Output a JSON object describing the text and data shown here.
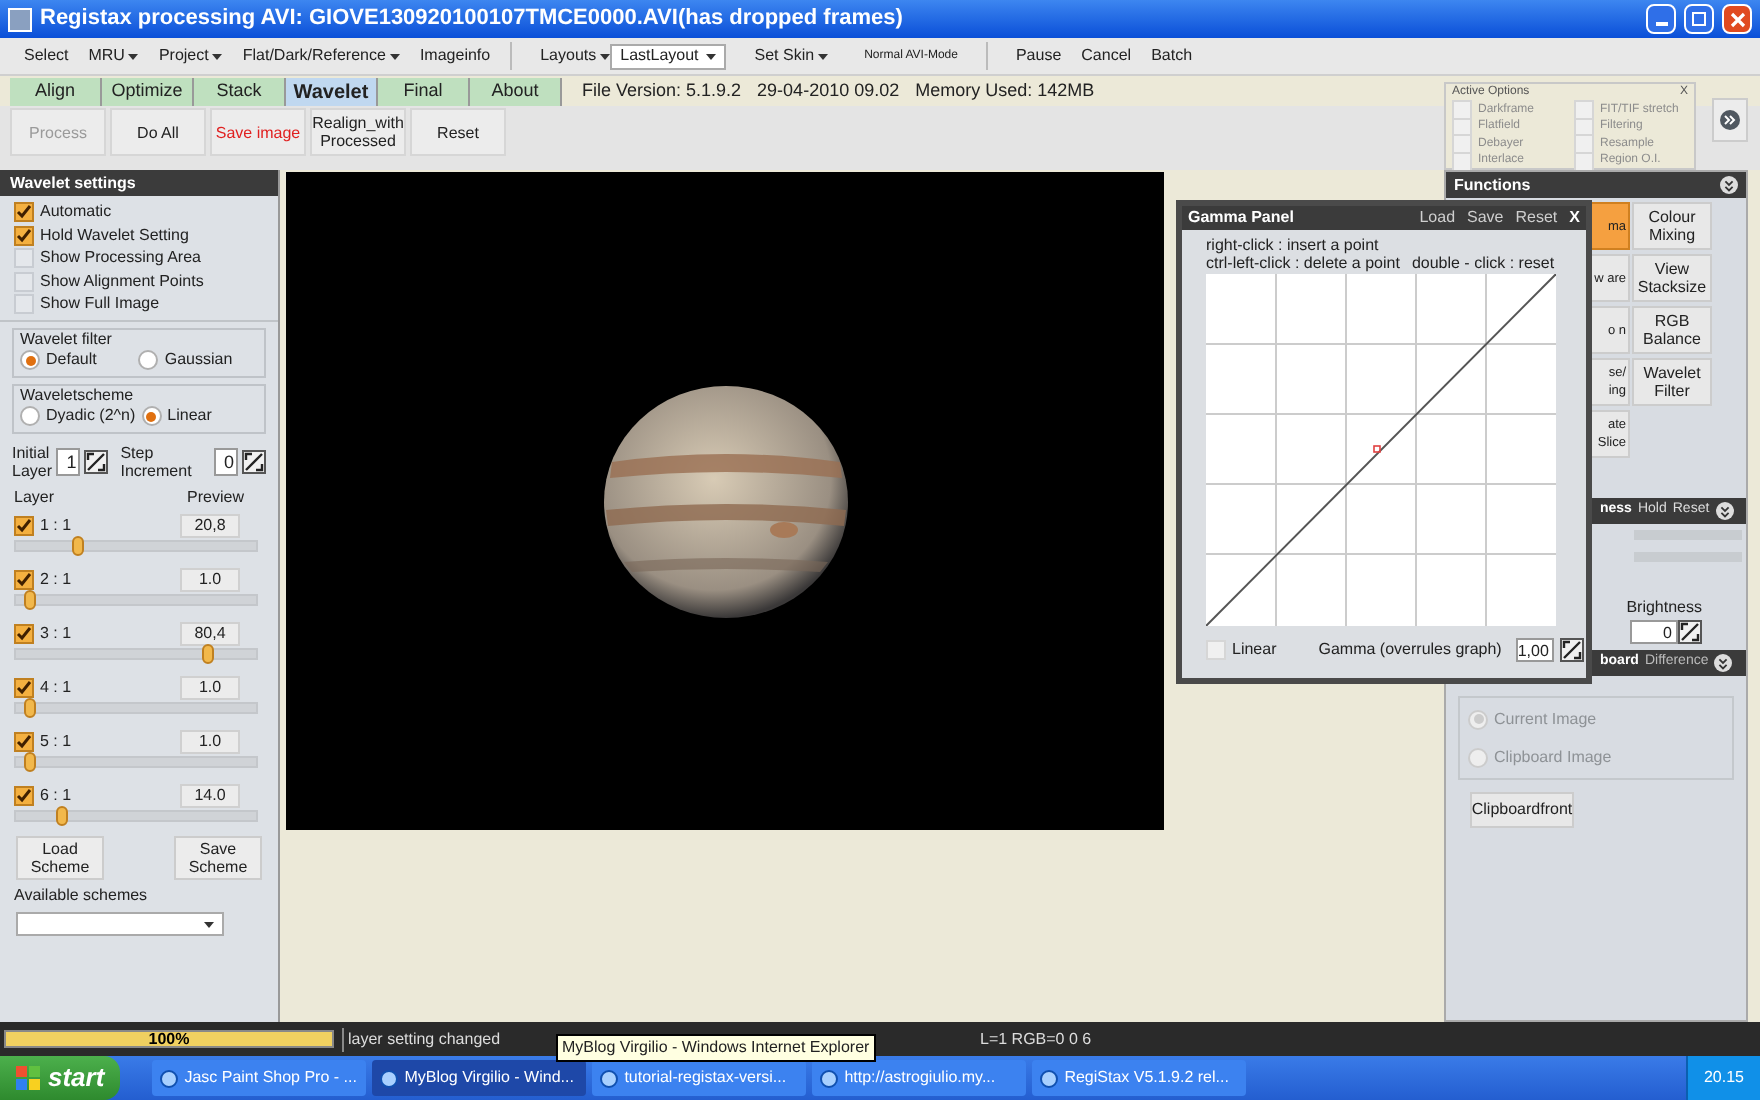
{
  "window": {
    "title": "Registax processing AVI: GIOVE130920100107TMCE0000.AVI(has dropped frames)"
  },
  "menu": [
    {
      "kind": "menu",
      "label": "Select",
      "dropdown": false
    },
    {
      "kind": "menu",
      "label": "MRU",
      "dropdown": true
    },
    {
      "kind": "menu",
      "label": "Project",
      "dropdown": true
    },
    {
      "kind": "menu",
      "label": "Flat/Dark/Reference",
      "dropdown": true
    },
    {
      "kind": "menu",
      "label": "Imageinfo",
      "dropdown": false
    },
    {
      "kind": "separator"
    },
    {
      "kind": "menu",
      "label": "Layouts",
      "dropdown": true
    },
    {
      "kind": "combo",
      "label": "LastLayout"
    },
    {
      "kind": "menu",
      "label": "Set Skin",
      "dropdown": true
    },
    {
      "kind": "small",
      "label": "Normal AVI-Mode"
    },
    {
      "kind": "separator"
    },
    {
      "kind": "menu",
      "label": "Pause",
      "dropdown": false
    },
    {
      "kind": "menu",
      "label": "Cancel",
      "dropdown": false
    },
    {
      "kind": "menu",
      "label": "Batch",
      "dropdown": false
    }
  ],
  "tabs": [
    {
      "label": "Align",
      "selected": false
    },
    {
      "label": "Optimize",
      "selected": false
    },
    {
      "label": "Stack",
      "selected": false
    },
    {
      "label": "Wavelet",
      "selected": true
    },
    {
      "label": "Final",
      "selected": false
    },
    {
      "label": "About",
      "selected": false
    }
  ],
  "file_info": [
    "File Version: 5.1.9.2",
    "29-04-2010 09.02",
    "Memory Used: 142MB"
  ],
  "toolbar": [
    {
      "label": "Process",
      "disabled": true,
      "warning": false
    },
    {
      "label": "Do All",
      "disabled": false,
      "warning": false
    },
    {
      "label": "Save image",
      "disabled": false,
      "warning": true
    },
    {
      "label": "Realign_with Processed",
      "disabled": false,
      "warning": false
    },
    {
      "label": "Reset",
      "disabled": false,
      "warning": false
    }
  ],
  "active_options": {
    "title": "Active Options",
    "close": "X",
    "items": [
      {
        "label": "Darkframe",
        "checked": false
      },
      {
        "label": "FIT/TIF stretch",
        "checked": false
      },
      {
        "label": "Flatfield",
        "checked": false
      },
      {
        "label": "Filtering",
        "checked": false
      },
      {
        "label": "Debayer",
        "checked": false
      },
      {
        "label": "Resample",
        "checked": false
      },
      {
        "label": "Interlace",
        "checked": false
      },
      {
        "label": "Region O.I.",
        "checked": false
      }
    ]
  },
  "wavelet_settings": {
    "title": "Wavelet settings",
    "options": [
      {
        "label": "Automatic",
        "checked": true
      },
      {
        "label": "Hold Wavelet Setting",
        "checked": true
      },
      {
        "label": "Show Processing Area",
        "checked": false
      },
      {
        "label": "Show Alignment Points",
        "checked": false
      },
      {
        "label": "Show Full Image",
        "checked": false
      }
    ],
    "filter": {
      "title": "Wavelet filter",
      "options": [
        {
          "label": "Default",
          "selected": true
        },
        {
          "label": "Gaussian",
          "selected": false
        }
      ]
    },
    "scheme": {
      "title": "Waveletscheme",
      "options": [
        {
          "label": "Dyadic (2^n)",
          "selected": false
        },
        {
          "label": "Linear",
          "selected": true
        }
      ]
    },
    "initial_layer": {
      "label": "Initial Layer",
      "value": "1"
    },
    "step_increment": {
      "label": "Step Increment",
      "value": "0"
    },
    "layer_header": "Layer",
    "preview_header": "Preview",
    "layers": [
      {
        "label": "1 : 1",
        "checked": true,
        "preview": "20,8",
        "level": 0.26
      },
      {
        "label": "2 : 1",
        "checked": true,
        "preview": "1.0",
        "level": 0.06
      },
      {
        "label": "3 : 1",
        "checked": true,
        "preview": "80,4",
        "level": 0.8
      },
      {
        "label": "4 : 1",
        "checked": true,
        "preview": "1.0",
        "level": 0.06
      },
      {
        "label": "5 : 1",
        "checked": true,
        "preview": "1.0",
        "level": 0.06
      },
      {
        "label": "6 : 1",
        "checked": true,
        "preview": "14.0",
        "level": 0.19
      }
    ],
    "buttons": [
      "Load Scheme",
      "Save Scheme"
    ],
    "available_label": "Available schemes"
  },
  "gamma_panel": {
    "title": "Gamma Panel",
    "actions": [
      "Load",
      "Save",
      "Reset"
    ],
    "close": "X",
    "hints": [
      "right-click : insert a point",
      "ctrl-left-click : delete a point",
      "double - click : reset"
    ],
    "linear": {
      "label": "Linear",
      "checked": false
    },
    "gamma_label": "Gamma (overrules graph)",
    "gamma_value": "1,00"
  },
  "functions": {
    "title": "Functions",
    "left_buttons": [
      {
        "label": "ma",
        "selected": true
      },
      {
        "label": "w are",
        "selected": false
      },
      {
        "label": "o n",
        "selected": false
      },
      {
        "label": "se/ ing",
        "selected": false
      },
      {
        "label": "ate Slice",
        "selected": false
      }
    ],
    "right_buttons": [
      {
        "label": "Colour Mixing",
        "selected": false
      },
      {
        "label": "View Stacksize",
        "selected": false
      },
      {
        "label": "RGB Balance",
        "selected": false
      },
      {
        "label": "Wavelet Filter",
        "selected": false
      }
    ]
  },
  "brightness_section": {
    "title": "ness",
    "actions": [
      "Hold",
      "Reset"
    ],
    "label": "Brightness",
    "value": "0"
  },
  "clipboard_section": {
    "title": "board",
    "tab": "Difference",
    "options": [
      {
        "label": "Current Image",
        "selected": true
      },
      {
        "label": "Clipboard Image",
        "selected": false
      }
    ],
    "disabled": true,
    "button": "Clipboardfront"
  },
  "status_bar": {
    "progress": {
      "text": "100%",
      "level": 1
    },
    "message": "layer setting changed",
    "info": "L=1 RGB=0 0 6"
  },
  "tooltip": "MyBlog Virgilio - Windows Internet Explorer",
  "taskbar": {
    "start": "start",
    "tasks": [
      {
        "label": "Jasc Paint Shop Pro - ...",
        "selected": false
      },
      {
        "label": "MyBlog Virgilio - Wind...",
        "selected": true
      },
      {
        "label": "tutorial-registax-versi...",
        "selected": false
      },
      {
        "label": "http://astrogiulio.my...",
        "selected": false
      },
      {
        "label": "RegiStax V5.1.9.2 rel...",
        "selected": false
      }
    ],
    "clock": "20.15"
  }
}
